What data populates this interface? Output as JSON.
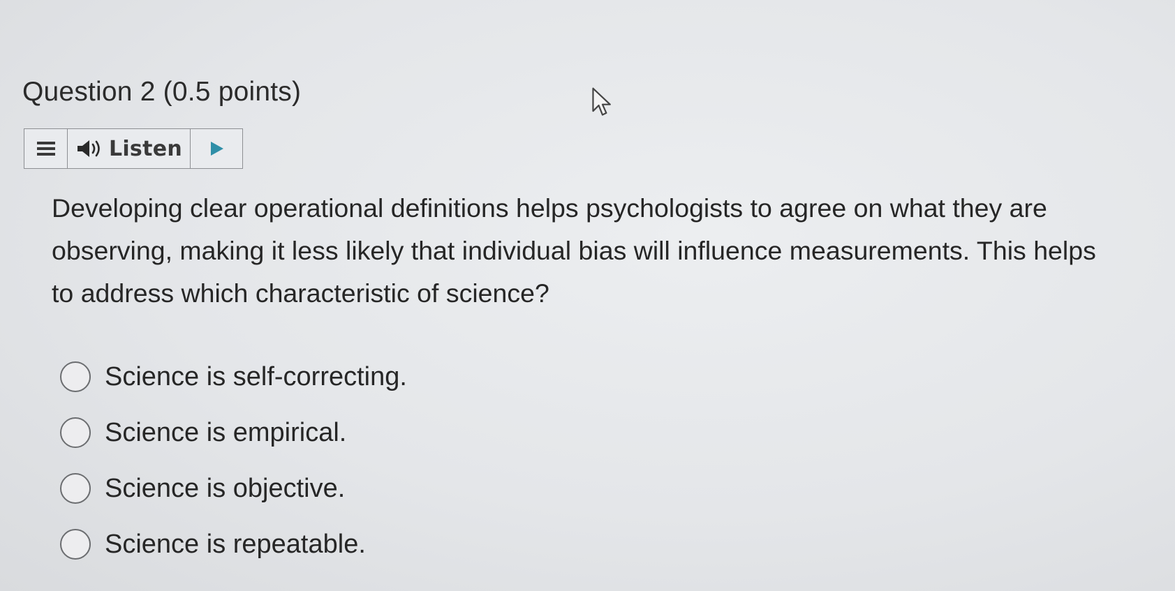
{
  "question": {
    "title": "Question 2 (0.5 points)",
    "text": "Developing clear operational definitions helps psychologists to agree on what they are observing, making it less likely that individual bias will influence measurements. This helps to address which characteristic of science?"
  },
  "listen_bar": {
    "menu_icon": "menu-icon",
    "speaker_icon": "speaker-icon",
    "label": "Listen",
    "play_icon": "play-icon",
    "accent_color": "#2f8fa8"
  },
  "options": [
    {
      "label": "Science is self-correcting.",
      "selected": false
    },
    {
      "label": "Science is empirical.",
      "selected": false
    },
    {
      "label": "Science is objective.",
      "selected": false
    },
    {
      "label": "Science is repeatable.",
      "selected": false
    }
  ]
}
